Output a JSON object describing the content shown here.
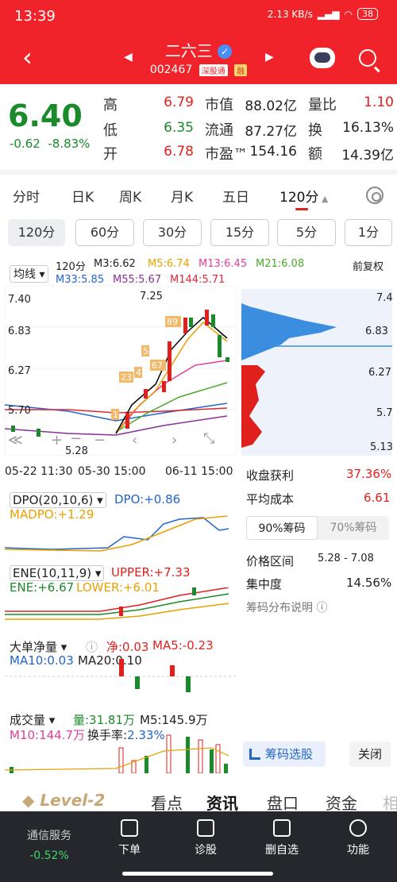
{
  "status": {
    "time": "13:39",
    "net_speed": "2.13 KB/s",
    "battery": "38"
  },
  "header": {
    "stock_name": "二六三",
    "stock_code": "002467",
    "tag1": "深股通",
    "tag2": "融"
  },
  "quote": {
    "price": "6.40",
    "change": "-0.62",
    "change_pct": "-8.83%",
    "high_label": "高",
    "high": "6.79",
    "low_label": "低",
    "low": "6.35",
    "open_label": "开",
    "open": "6.78",
    "mcap_label": "市值",
    "mcap": "88.02亿",
    "float_label": "流通",
    "float": "87.27亿",
    "pe_label": "市盈™",
    "pe": "154.16",
    "vr_label": "量比",
    "vr": "1.10",
    "turn_label": "换",
    "turn": "16.13%",
    "amt_label": "额",
    "amt": "14.39亿"
  },
  "tabs": [
    "分时",
    "日K",
    "周K",
    "月K",
    "五日",
    "120分"
  ],
  "periods": [
    "120分",
    "60分",
    "30分",
    "15分",
    "5分",
    "1分"
  ],
  "ma": {
    "label": "均线",
    "period": "120分",
    "m3": "M3:6.62",
    "m5": "M5:6.74",
    "m13": "M13:6.45",
    "m21": "M21:6.08",
    "m33": "M33:5.85",
    "m55": "M55:5.67",
    "m144": "M144:5.71",
    "adj": "前复权"
  },
  "axis": {
    "y1": "7.40",
    "y2": "6.83",
    "y3": "6.27",
    "y4": "5.70",
    "high_mark": "7.25",
    "low_mark": "5.28",
    "x1": "05-22 11:30",
    "x2": "05-30 15:00",
    "x3": "06-11 15:00",
    "r1": "7.4",
    "r2": "6.83",
    "r3": "6.27",
    "r4": "5.7",
    "r5": "5.13"
  },
  "dpo": {
    "title": "DPO(20,10,6)",
    "dpo": "DPO:+0.86",
    "madpo": "MADPO:+1.29"
  },
  "ene": {
    "title": "ENE(10,11,9)",
    "upper": "UPPER:+7.33",
    "ene": "ENE:+6.67",
    "lower": "LOWER:+6.01"
  },
  "big": {
    "title": "大单净量",
    "net": "净:0.03",
    "ma5": "MA5:-0.23",
    "ma10": "MA10:0.03",
    "ma20": "MA20:0.10"
  },
  "vol": {
    "title": "成交量",
    "vol": "量:31.81万",
    "m5": "M5:145.9万",
    "m10": "M10:144.7万",
    "turnover_label": "换手率:",
    "turnover": "2.33%"
  },
  "chips": {
    "profit_label": "收盘获利",
    "profit": "37.36%",
    "cost_label": "平均成本",
    "cost": "6.61",
    "tab90": "90%筹码",
    "tab70": "70%筹码",
    "range_label": "价格区间",
    "range": "5.28 - 7.08",
    "conc_label": "集中度",
    "conc": "14.56%",
    "explain": "筹码分布说明",
    "select_btn": "筹码选股",
    "close_btn": "关闭"
  },
  "bottom_tabs": [
    "Level-2",
    "看点",
    "资讯",
    "盘口",
    "资金",
    "相"
  ],
  "nav": {
    "service": "通信服务",
    "service_pct": "-0.52%",
    "sell": "下单",
    "diag": "诊股",
    "del": "删自选",
    "func": "功能"
  },
  "colors": {
    "red": "#f0232a",
    "green": "#1a8a2a",
    "blue": "#2366c8"
  }
}
